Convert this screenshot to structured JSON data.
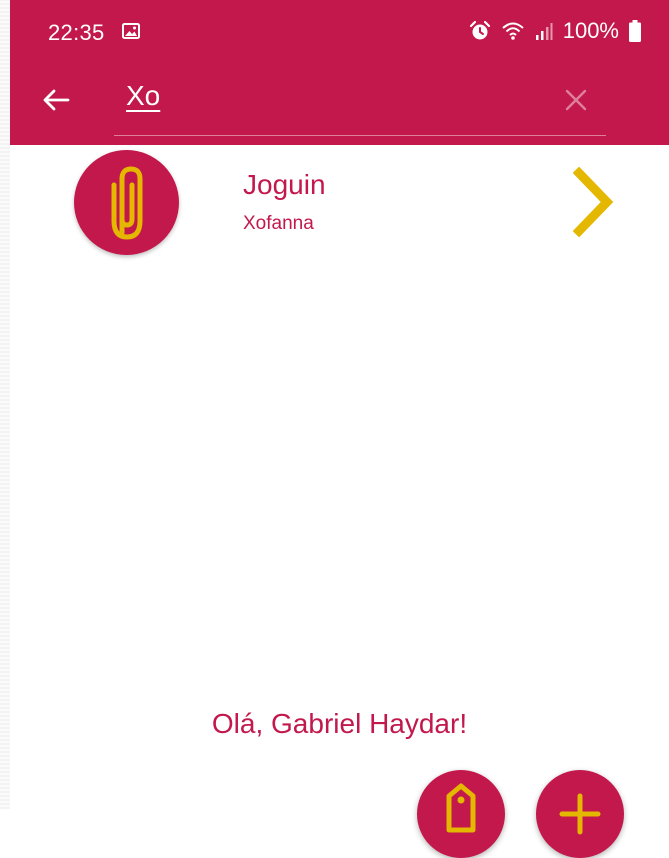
{
  "status_bar": {
    "time": "22:35",
    "battery": "100%"
  },
  "search": {
    "value": "Xo"
  },
  "results": [
    {
      "title": "Joguin",
      "subtitle": "Xofanna"
    }
  ],
  "greeting": "Olá, Gabriel Haydar!",
  "colors": {
    "primary": "#C2184C",
    "accent": "#E4B800"
  },
  "icons": {
    "back": "arrow-left-icon",
    "clear": "close-icon",
    "avatar": "paperclip-icon",
    "open": "chevron-right-icon",
    "fab_left": "tag-icon",
    "fab_right": "plus-icon"
  }
}
